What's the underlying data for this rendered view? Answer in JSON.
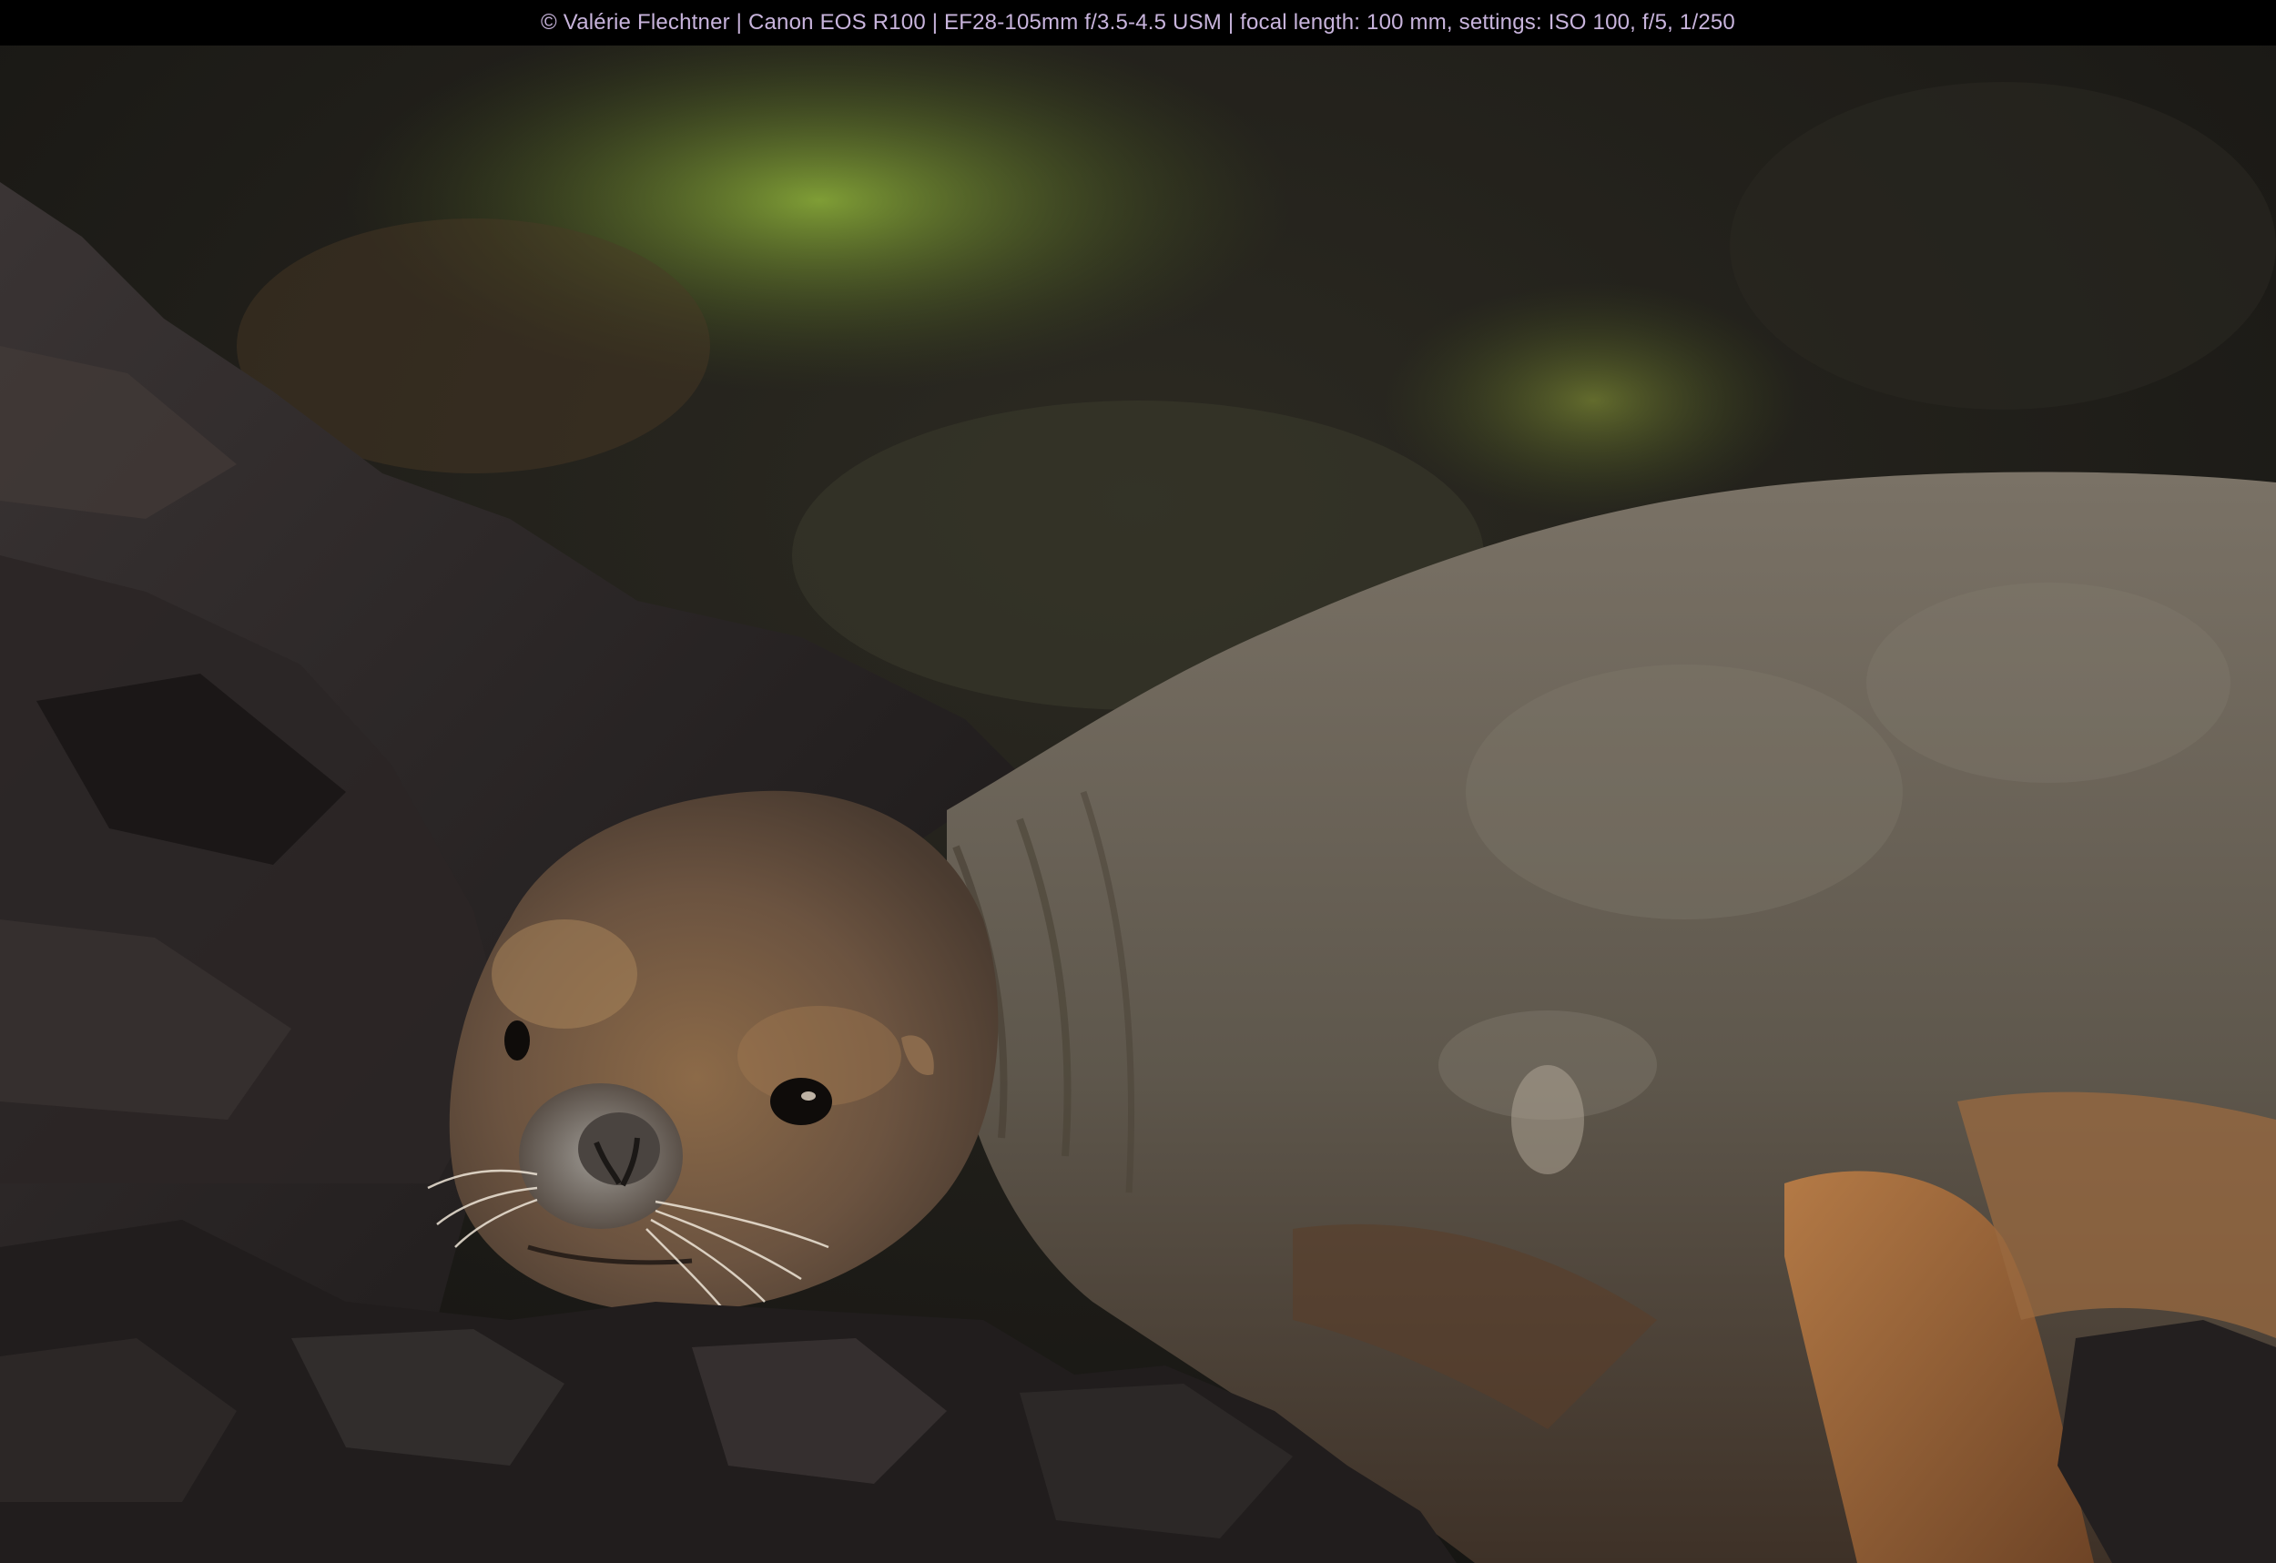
{
  "caption": {
    "text": "© Valérie Flechtner | Canon EOS R100 | EF28-105mm f/3.5-4.5 USM | focal length: 100 mm, settings: ISO 100, f/5, 1/250"
  },
  "photo": {
    "subject": "sea-lion",
    "colors": {
      "background_dark": "#1c1b16",
      "moss": "#6f8a2c",
      "rock": "#2a2626",
      "fur_gray": "#6b6256",
      "fur_brown": "#8a6440",
      "flipper": "#a06a3c"
    }
  }
}
